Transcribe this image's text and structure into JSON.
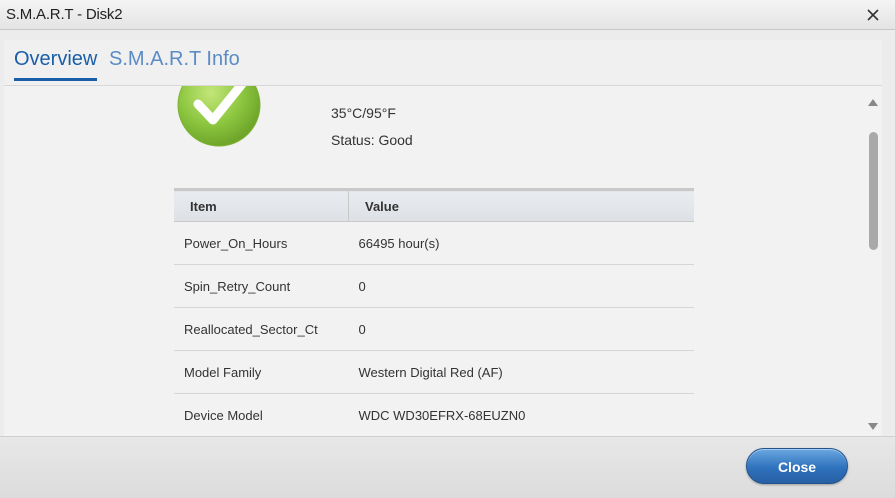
{
  "window": {
    "title": "S.M.A.R.T - Disk2"
  },
  "tabs": [
    {
      "label": "Overview",
      "active": true
    },
    {
      "label": "S.M.A.R.T Info",
      "active": false
    }
  ],
  "overview": {
    "status_icon": "check-icon",
    "temperature": "35°C/95°F",
    "status": "Status: Good"
  },
  "table": {
    "columns": [
      "Item",
      "Value"
    ],
    "rows": [
      [
        "Power_On_Hours",
        "66495 hour(s)"
      ],
      [
        "Spin_Retry_Count",
        "0"
      ],
      [
        "Reallocated_Sector_Ct",
        "0"
      ],
      [
        "Model Family",
        "Western Digital Red (AF)"
      ],
      [
        "Device Model",
        "WDC WD30EFRX-68EUZN0"
      ]
    ]
  },
  "footer": {
    "close_label": "Close"
  },
  "colors": {
    "accent": "#1a5ea8",
    "tab_inactive": "#5b8bc5",
    "button": "#2f72bd",
    "check": "#8cc63f"
  }
}
